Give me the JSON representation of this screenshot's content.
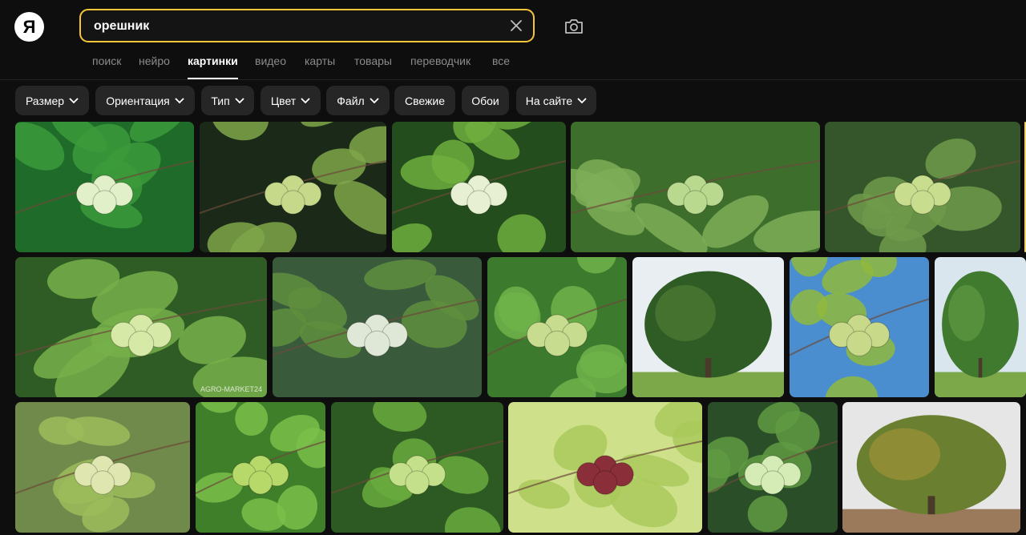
{
  "logo": {
    "letter": "Я"
  },
  "search": {
    "value": "орешник"
  },
  "tabs": [
    {
      "label": "поиск"
    },
    {
      "label": "нейро"
    },
    {
      "label": "картинки",
      "active": true
    },
    {
      "label": "видео"
    },
    {
      "label": "карты"
    },
    {
      "label": "товары"
    },
    {
      "label": "переводчик"
    },
    {
      "label": "все"
    }
  ],
  "filters": [
    {
      "label": "Размер",
      "dropdown": true
    },
    {
      "label": "Ориентация",
      "dropdown": true
    },
    {
      "label": "Тип",
      "dropdown": true
    },
    {
      "label": "Цвет",
      "dropdown": true
    },
    {
      "label": "Файл",
      "dropdown": true
    },
    {
      "label": "Свежие",
      "dropdown": false
    },
    {
      "label": "Обои",
      "dropdown": false
    },
    {
      "label": "На сайте",
      "dropdown": true
    }
  ],
  "results": {
    "watermark": "AGRO-MARKET24",
    "images": [
      {
        "subject": "hazelnut-cluster-leaves",
        "colors": {
          "bg": "#1f6b2a",
          "leaf": "#3c9a3a",
          "nut": "#e2f0c9"
        }
      },
      {
        "subject": "hazelnut-cluster-dark",
        "colors": {
          "bg": "#1b2a18",
          "leaf": "#7fa64a",
          "nut": "#c6d98a"
        }
      },
      {
        "subject": "hazelnut-branch",
        "colors": {
          "bg": "#234d1c",
          "leaf": "#6fae3e",
          "nut": "#e7f0d2"
        }
      },
      {
        "subject": "hazel-bush-foliage",
        "colors": {
          "bg": "#3e6e2c",
          "leaf": "#7fae58",
          "nut": "#b9d98e"
        }
      },
      {
        "subject": "hazel-branch-leaves",
        "colors": {
          "bg": "#35562a",
          "leaf": "#6f9a4a",
          "nut": "#c9dd8f"
        }
      },
      {
        "subject": "hazel-branch-watermarked",
        "colors": {
          "bg": "#2f5b25",
          "leaf": "#77b04a",
          "nut": "#d6e9a6"
        }
      },
      {
        "subject": "hazelnut-cluster-closeup",
        "colors": {
          "bg": "#3a5a3c",
          "leaf": "#5f8f3d",
          "nut": "#dfe8d6"
        }
      },
      {
        "subject": "hazelnut-green-husks",
        "colors": {
          "bg": "#3c7a2e",
          "leaf": "#6fb34a",
          "nut": "#c7dc8e"
        }
      },
      {
        "subject": "hazel-tree-meadow",
        "colors": {
          "bg": "#e9eef2",
          "leaf": "#2f5b25",
          "nut": "#5b8a3a"
        }
      },
      {
        "subject": "hazelnut-husk-sky",
        "colors": {
          "bg": "#4a8ecf",
          "leaf": "#8fb93c",
          "nut": "#c9d98a"
        }
      },
      {
        "subject": "hazel-tree-green",
        "colors": {
          "bg": "#d9e6ee",
          "leaf": "#3f7a2f",
          "nut": "#6fa54a"
        }
      },
      {
        "subject": "hazelnut-pair-twig",
        "colors": {
          "bg": "#6f8a4a",
          "leaf": "#9cbc5a",
          "nut": "#dfe6b0"
        }
      },
      {
        "subject": "hazelnut-husk-bright",
        "colors": {
          "bg": "#3f7f2a",
          "leaf": "#7ac04a",
          "nut": "#b6d96a"
        }
      },
      {
        "subject": "hazel-bush-dense",
        "colors": {
          "bg": "#2c5a22",
          "leaf": "#6aaa3e",
          "nut": "#c4e08a"
        }
      },
      {
        "subject": "purple-hazelnuts",
        "colors": {
          "bg": "#cfe08a",
          "leaf": "#a9c95a",
          "nut": "#8a2f3a"
        }
      },
      {
        "subject": "hazelnut-cluster-white",
        "colors": {
          "bg": "#2a4f28",
          "leaf": "#5f9a42",
          "nut": "#d6ecb6"
        }
      },
      {
        "subject": "hazel-tree-orchard",
        "colors": {
          "bg": "#e6e6e6",
          "leaf": "#6a7f30",
          "nut": "#b29a3a"
        }
      }
    ]
  }
}
